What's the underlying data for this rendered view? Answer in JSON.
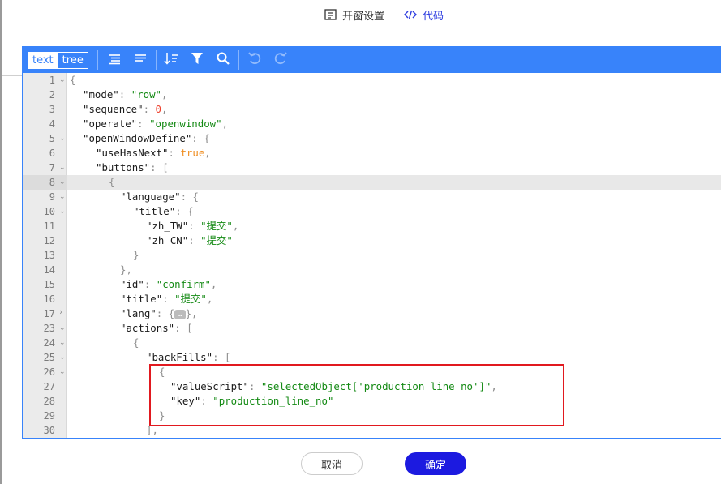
{
  "header": {
    "tabs": [
      {
        "label": "开窗设置",
        "icon": "settings-doc-icon"
      },
      {
        "label": "代码",
        "icon": "code-icon"
      }
    ],
    "active_color": "#2f3ee0"
  },
  "editor": {
    "mode_buttons": [
      {
        "label": "text",
        "active": true
      },
      {
        "label": "tree",
        "active": false
      }
    ],
    "toolbar_icons": [
      "format-icon",
      "compact-icon",
      "sort-icon",
      "filter-icon",
      "search-icon",
      "undo-icon",
      "redo-icon"
    ],
    "accent_color": "#3883fa",
    "collapsed_placeholder": "…",
    "lines": [
      {
        "n": "1",
        "fold": "open"
      },
      {
        "n": "2",
        "fold": ""
      },
      {
        "n": "3",
        "fold": ""
      },
      {
        "n": "4",
        "fold": ""
      },
      {
        "n": "5",
        "fold": "open"
      },
      {
        "n": "6",
        "fold": ""
      },
      {
        "n": "7",
        "fold": "open"
      },
      {
        "n": "8",
        "fold": "open"
      },
      {
        "n": "9",
        "fold": "open"
      },
      {
        "n": "10",
        "fold": "open"
      },
      {
        "n": "11",
        "fold": ""
      },
      {
        "n": "12",
        "fold": ""
      },
      {
        "n": "13",
        "fold": ""
      },
      {
        "n": "14",
        "fold": ""
      },
      {
        "n": "15",
        "fold": ""
      },
      {
        "n": "16",
        "fold": ""
      },
      {
        "n": "17",
        "fold": "closed"
      },
      {
        "n": "23",
        "fold": "open"
      },
      {
        "n": "24",
        "fold": "open"
      },
      {
        "n": "25",
        "fold": "open"
      },
      {
        "n": "26",
        "fold": "open"
      },
      {
        "n": "27",
        "fold": ""
      },
      {
        "n": "28",
        "fold": ""
      },
      {
        "n": "29",
        "fold": ""
      },
      {
        "n": "30",
        "fold": ""
      }
    ],
    "code": {
      "l1_open": "{",
      "mode_key": "\"mode\"",
      "mode_val": "\"row\"",
      "sequence_key": "\"sequence\"",
      "sequence_val": "0",
      "operate_key": "\"operate\"",
      "operate_val": "\"openwindow\"",
      "owd_key": "\"openWindowDefine\"",
      "owd_open": "{",
      "uhn_key": "\"useHasNext\"",
      "uhn_val": "true",
      "buttons_key": "\"buttons\"",
      "buttons_open": "[",
      "obj_open": "{",
      "language_key": "\"language\"",
      "language_open": "{",
      "title_key": "\"title\"",
      "title_open": "{",
      "zh_tw_key": "\"zh_TW\"",
      "zh_tw_val": "\"提交\"",
      "zh_cn_key": "\"zh_CN\"",
      "zh_cn_val": "\"提交\"",
      "inner_close": "}",
      "lang_close": "},",
      "id_key": "\"id\"",
      "id_val": "\"confirm\"",
      "title2_key": "\"title\"",
      "title2_val": "\"提交\"",
      "lang_key": "\"lang\"",
      "actions_key": "\"actions\"",
      "actions_open": "[",
      "act_obj_open": "{",
      "backfills_key": "\"backFills\"",
      "backfills_open": "[",
      "bf_obj_open": "{",
      "vs_key": "\"valueScript\"",
      "vs_val": "\"selectedObject['production_line_no']\"",
      "key_key": "\"key\"",
      "key_val": "\"production_line_no\"",
      "bf_obj_close": "}",
      "bf_close": "],"
    }
  },
  "footer": {
    "cancel_label": "取消",
    "confirm_label": "确定",
    "confirm_color": "#1c1ae0"
  },
  "annotation_color": "#e1191f"
}
